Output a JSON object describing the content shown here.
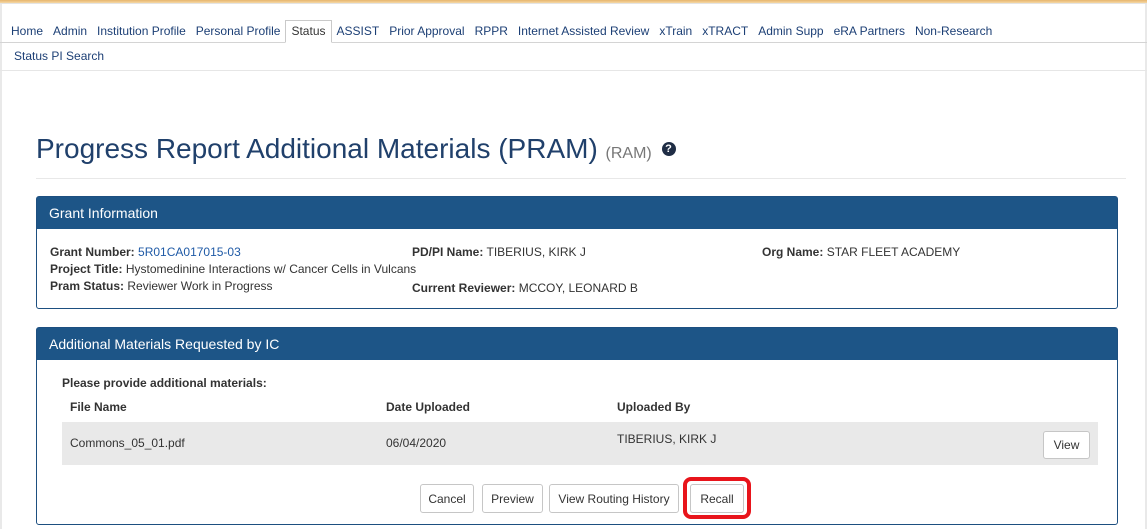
{
  "nav": {
    "tabs": [
      "Home",
      "Admin",
      "Institution Profile",
      "Personal Profile",
      "Status",
      "ASSIST",
      "Prior Approval",
      "RPPR",
      "Internet Assisted Review",
      "xTrain",
      "xTRACT",
      "Admin Supp",
      "eRA Partners",
      "Non-Research"
    ],
    "active_tab": "Status",
    "subnav_item": "Status PI Search"
  },
  "page": {
    "title": "Progress Report Additional Materials (PRAM)",
    "abbr": "(RAM)",
    "help_icon": "question-circle-icon"
  },
  "grant_info": {
    "heading": "Grant Information",
    "grant_number_label": "Grant Number:",
    "grant_number": "5R01CA017015-03",
    "project_title_label": "Project Title:",
    "project_title": "Hystomedinine Interactions w/ Cancer Cells in Vulcans",
    "pram_status_label": "Pram Status:",
    "pram_status": "Reviewer Work in Progress",
    "pi_label": "PD/PI Name:",
    "pi_name": "TIBERIUS, KIRK J",
    "reviewer_label": "Current Reviewer:",
    "reviewer_name": "MCCOY, LEONARD B",
    "org_label": "Org Name:",
    "org_name": "STAR FLEET ACADEMY"
  },
  "materials": {
    "heading": "Additional Materials Requested by IC",
    "prompt": "Please provide additional materials:",
    "columns": [
      "File Name",
      "Date Uploaded",
      "Uploaded By"
    ],
    "rows": [
      {
        "file": "Commons_05_01.pdf",
        "date": "06/04/2020",
        "by": "TIBERIUS, KIRK J",
        "action": "View"
      }
    ]
  },
  "actions": {
    "cancel": "Cancel",
    "preview": "Preview",
    "routing": "View Routing History",
    "recall": "Recall"
  },
  "colors": {
    "header_blue": "#1d5587",
    "title_blue": "#20406b",
    "highlight_red": "#e8141b"
  }
}
